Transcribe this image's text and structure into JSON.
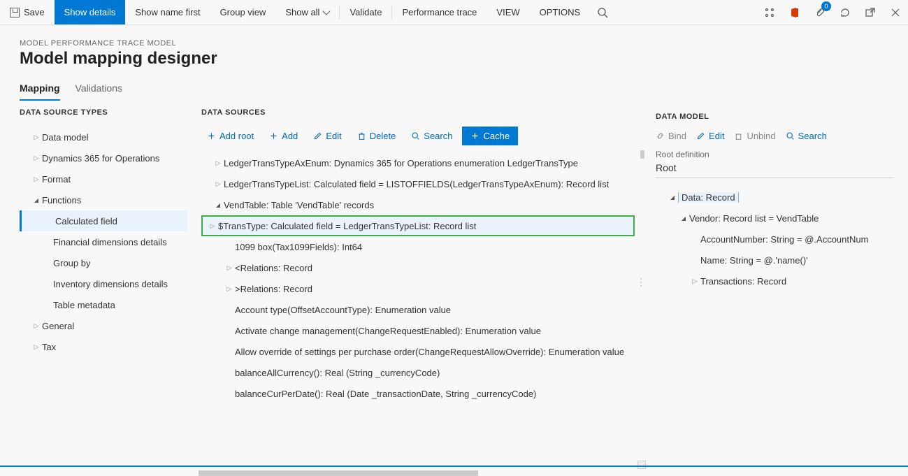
{
  "cmdbar": {
    "save": "Save",
    "show_details": "Show details",
    "show_name_first": "Show name first",
    "group_view": "Group view",
    "show_all": "Show all",
    "validate": "Validate",
    "perf_trace": "Performance trace",
    "view": "VIEW",
    "options": "OPTIONS",
    "badge_count": "0"
  },
  "header": {
    "breadcrumb": "MODEL PERFORMANCE TRACE MODEL",
    "title": "Model mapping designer"
  },
  "tabs": {
    "mapping": "Mapping",
    "validations": "Validations"
  },
  "left": {
    "title": "DATA SOURCE TYPES",
    "items": [
      {
        "label": "Data model",
        "caret": "right",
        "indent": 1
      },
      {
        "label": "Dynamics 365 for Operations",
        "caret": "right",
        "indent": 1
      },
      {
        "label": "Format",
        "caret": "right",
        "indent": 1
      },
      {
        "label": "Functions",
        "caret": "down",
        "indent": 1
      },
      {
        "label": "Calculated field",
        "caret": "",
        "indent": 2,
        "selected": true
      },
      {
        "label": "Financial dimensions details",
        "caret": "",
        "indent": 2
      },
      {
        "label": "Group by",
        "caret": "",
        "indent": 2
      },
      {
        "label": "Inventory dimensions details",
        "caret": "",
        "indent": 2
      },
      {
        "label": "Table metadata",
        "caret": "",
        "indent": 2
      },
      {
        "label": "General",
        "caret": "right",
        "indent": 1
      },
      {
        "label": "Tax",
        "caret": "right",
        "indent": 1
      }
    ]
  },
  "mid": {
    "title": "DATA SOURCES",
    "toolbar": {
      "add_root": "Add root",
      "add": "Add",
      "edit": "Edit",
      "delete": "Delete",
      "search": "Search",
      "cache": "Cache"
    },
    "rows": [
      {
        "label": "LedgerTransTypeAxEnum: Dynamics 365 for Operations enumeration LedgerTransType",
        "caret": "right",
        "indent": 1
      },
      {
        "label": "LedgerTransTypeList: Calculated field = LISTOFFIELDS(LedgerTransTypeAxEnum): Record list",
        "caret": "right",
        "indent": 1
      },
      {
        "label": "VendTable: Table 'VendTable' records",
        "caret": "down",
        "indent": 1
      },
      {
        "label": "$TransType: Calculated field = LedgerTransTypeList: Record list",
        "caret": "right",
        "indent": 2,
        "green": true,
        "soft": true
      },
      {
        "label": "1099 box(Tax1099Fields): Int64",
        "caret": "",
        "indent": 2
      },
      {
        "label": "<Relations: Record",
        "caret": "right",
        "indent": 2
      },
      {
        "label": ">Relations: Record",
        "caret": "right",
        "indent": 2
      },
      {
        "label": "Account type(OffsetAccountType): Enumeration value",
        "caret": "",
        "indent": 2
      },
      {
        "label": "Activate change management(ChangeRequestEnabled): Enumeration value",
        "caret": "",
        "indent": 2
      },
      {
        "label": "Allow override of settings per purchase order(ChangeRequestAllowOverride): Enumeration value",
        "caret": "",
        "indent": 2
      },
      {
        "label": "balanceAllCurrency(): Real (String _currencyCode)",
        "caret": "",
        "indent": 2
      },
      {
        "label": "balanceCurPerDate(): Real (Date _transactionDate, String _currencyCode)",
        "caret": "",
        "indent": 2
      }
    ]
  },
  "right": {
    "title": "DATA MODEL",
    "toolbar": {
      "bind": "Bind",
      "edit": "Edit",
      "unbind": "Unbind",
      "search": "Search"
    },
    "root_def_label": "Root definition",
    "root_def_value": "Root",
    "rows": [
      {
        "label": "Data: Record",
        "caret": "down",
        "indent": 1,
        "outline": true
      },
      {
        "label": "Vendor: Record list = VendTable",
        "caret": "down",
        "indent": 2
      },
      {
        "label": "AccountNumber: String = @.AccountNum",
        "caret": "",
        "indent": 3
      },
      {
        "label": "Name: String = @.'name()'",
        "caret": "",
        "indent": 3
      },
      {
        "label": "Transactions: Record",
        "caret": "right",
        "indent": 3
      }
    ]
  }
}
